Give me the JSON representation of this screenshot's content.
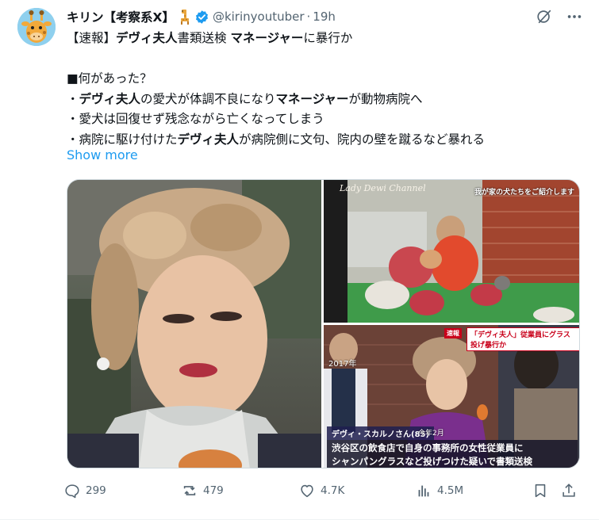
{
  "author": {
    "display_name": "キリン【考察系X】",
    "handle": "@kirinyoutuber",
    "dot": "·",
    "time": "19h",
    "avatar_icon": "giraffe-avatar-icon",
    "verified_icon": "verified-badge-icon"
  },
  "tweet": {
    "headline_prefix": "【速報】",
    "headline_bold1": "デヴィ夫人",
    "headline_mid": "書類送検 ",
    "headline_bold2": "マネージャー",
    "headline_suffix": "に暴行か",
    "section_title": "■何があった？",
    "b1_prefix": "・",
    "b1_bold1": "デヴィ夫人",
    "b1_mid": "の愛犬が体調不良になり",
    "b1_bold2": "マネージャー",
    "b1_suffix": "が動物病院へ",
    "b2": "・愛犬は回復せず残念ながら亡くなってしまう",
    "b3_prefix": "・病院に駆け付けた",
    "b3_bold": "デヴィ夫人",
    "b3_suffix": "が病院側に文句、院内の壁を蹴るなど暴れる",
    "show_more": "Show more"
  },
  "media": {
    "photo2_title": "Lady Dewi Channel",
    "photo2_caption": "我が家の犬たちをご紹介します",
    "photo3_breaking": "速報",
    "photo3_headline": "「デヴィ夫人」従業員にグラス投げ暴行か",
    "photo3_year": "2017年",
    "photo3_name": "デヴィ・スカルノさん(85)",
    "photo3_date": "今年2月",
    "photo3_sub1": "渋谷区の飲食店で自身の事務所の女性従業員に",
    "photo3_sub2": "シャンパングラスなど投げつけた疑いで書類送検"
  },
  "stats": {
    "replies": "299",
    "reposts": "479",
    "likes": "4.7K",
    "views": "4.5M"
  },
  "colors": {
    "accent": "#1d9bf0",
    "text": "#0f1419",
    "muted": "#536471",
    "border": "#cfd9de"
  }
}
